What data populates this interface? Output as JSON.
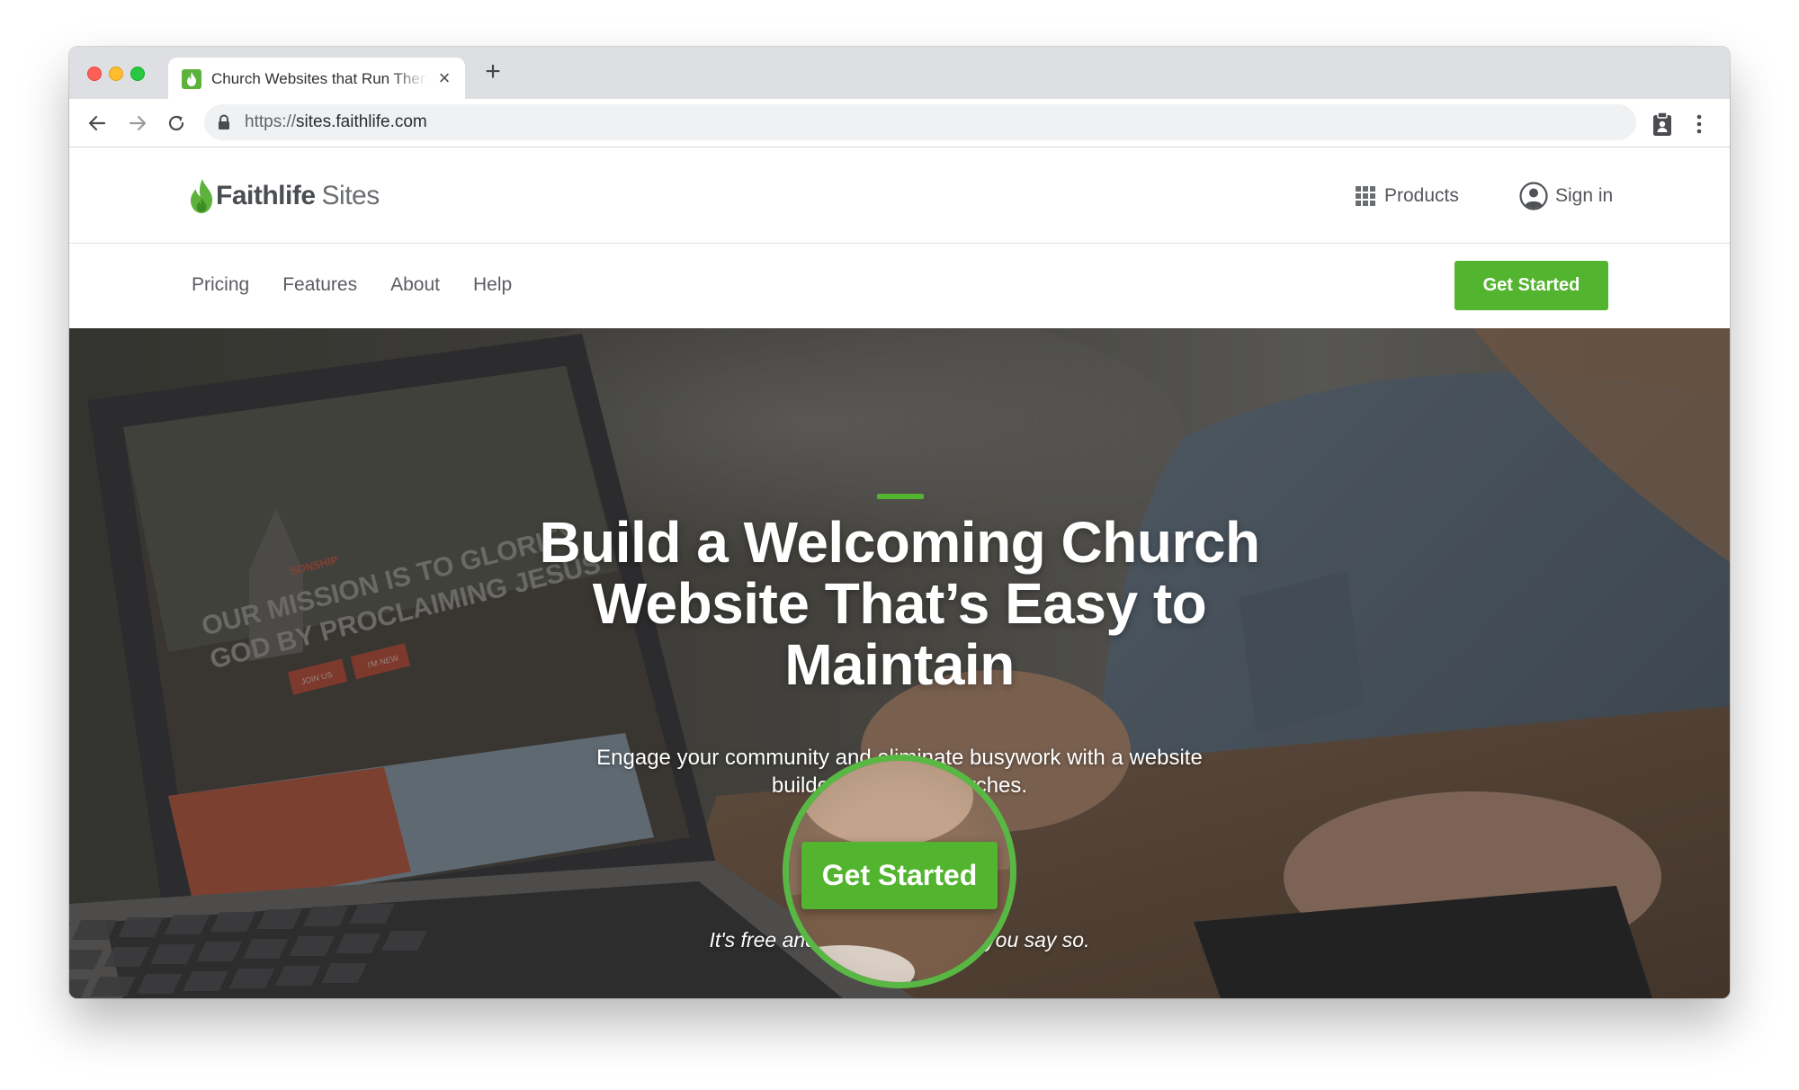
{
  "browser": {
    "tab_title": "Church Websites that Run Themselves",
    "tab_close_glyph": "×",
    "new_tab_glyph": "+",
    "url_scheme": "https://",
    "url_host": "sites.faithlife.com",
    "icons": {
      "back": "arrow-left-icon",
      "forward": "arrow-right-icon",
      "reload": "reload-icon",
      "lock": "lock-icon",
      "extension": "clipboard-icon",
      "menu": "more-vertical-icon",
      "favicon": "flame-icon"
    }
  },
  "site": {
    "logo_bold": "Faithlife",
    "logo_light": "Sites",
    "products_label": "Products",
    "signin_label": "Sign in",
    "nav": [
      "Pricing",
      "Features",
      "About",
      "Help"
    ],
    "header_cta": "Get Started",
    "colors": {
      "brand_green": "#53b42f",
      "highlight_ring": "#59b844"
    }
  },
  "hero": {
    "heading": "Build a Welcoming Church Website That’s Easy to Maintain",
    "subheading": "Engage your community and eliminate busywork with a website builder made for churches.",
    "cta": "Get Started",
    "note": "It's free and won't go live until you say so.",
    "laptop_screen": {
      "kicker": "SONSHIP",
      "headline_line1": "OUR MISSION IS TO GLORIFY",
      "headline_line2": "GOD BY PROCLAIMING JESUS",
      "button_left": "JOIN US",
      "button_right": "I'M NEW"
    }
  }
}
